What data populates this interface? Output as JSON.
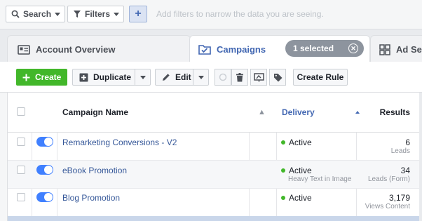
{
  "filterbar": {
    "search_label": "Search",
    "filters_label": "Filters",
    "add_label": "+",
    "hint": "Add filters to narrow the data you are seeing."
  },
  "tabs": [
    {
      "label": "Account Overview"
    },
    {
      "label": "Campaigns"
    },
    {
      "label": "Ad Se"
    }
  ],
  "selection": {
    "label": "1 selected",
    "clear_glyph": "✕"
  },
  "toolbar": {
    "create_label": "Create",
    "duplicate_label": "Duplicate",
    "edit_label": "Edit",
    "create_rule_label": "Create Rule"
  },
  "table": {
    "headers": {
      "name": "Campaign Name",
      "warning": "▲",
      "delivery": "Delivery",
      "results": "Results"
    },
    "rows": [
      {
        "name": "Remarketing Conversions - V2",
        "delivery": "Active",
        "delivery_note": "",
        "result": "6",
        "result_label": "Leads"
      },
      {
        "name": "eBook Promotion",
        "delivery": "Active",
        "delivery_note": "Heavy Text in Image",
        "result": "34",
        "result_label": "Leads (Form)"
      },
      {
        "name": "Blog Promotion",
        "delivery": "Active",
        "delivery_note": "",
        "result": "3,179",
        "result_label": "Views Content"
      }
    ]
  },
  "colors": {
    "accent": "#4267b2",
    "create": "#42b72a",
    "toggle": "#4080ff",
    "link": "#365899"
  }
}
